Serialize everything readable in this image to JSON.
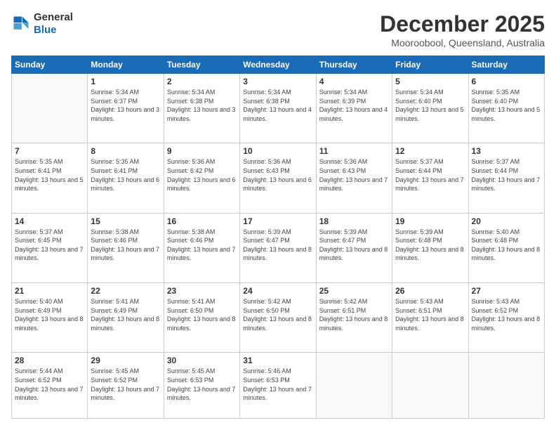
{
  "logo": {
    "line1": "General",
    "line2": "Blue"
  },
  "title": "December 2025",
  "subtitle": "Mooroobool, Queensland, Australia",
  "days_of_week": [
    "Sunday",
    "Monday",
    "Tuesday",
    "Wednesday",
    "Thursday",
    "Friday",
    "Saturday"
  ],
  "weeks": [
    [
      {
        "day": "",
        "sunrise": "",
        "sunset": "",
        "daylight": ""
      },
      {
        "day": "1",
        "sunrise": "Sunrise: 5:34 AM",
        "sunset": "Sunset: 6:37 PM",
        "daylight": "Daylight: 13 hours and 3 minutes."
      },
      {
        "day": "2",
        "sunrise": "Sunrise: 5:34 AM",
        "sunset": "Sunset: 6:38 PM",
        "daylight": "Daylight: 13 hours and 3 minutes."
      },
      {
        "day": "3",
        "sunrise": "Sunrise: 5:34 AM",
        "sunset": "Sunset: 6:38 PM",
        "daylight": "Daylight: 13 hours and 4 minutes."
      },
      {
        "day": "4",
        "sunrise": "Sunrise: 5:34 AM",
        "sunset": "Sunset: 6:39 PM",
        "daylight": "Daylight: 13 hours and 4 minutes."
      },
      {
        "day": "5",
        "sunrise": "Sunrise: 5:34 AM",
        "sunset": "Sunset: 6:40 PM",
        "daylight": "Daylight: 13 hours and 5 minutes."
      },
      {
        "day": "6",
        "sunrise": "Sunrise: 5:35 AM",
        "sunset": "Sunset: 6:40 PM",
        "daylight": "Daylight: 13 hours and 5 minutes."
      }
    ],
    [
      {
        "day": "7",
        "sunrise": "Sunrise: 5:35 AM",
        "sunset": "Sunset: 6:41 PM",
        "daylight": "Daylight: 13 hours and 5 minutes."
      },
      {
        "day": "8",
        "sunrise": "Sunrise: 5:35 AM",
        "sunset": "Sunset: 6:41 PM",
        "daylight": "Daylight: 13 hours and 6 minutes."
      },
      {
        "day": "9",
        "sunrise": "Sunrise: 5:36 AM",
        "sunset": "Sunset: 6:42 PM",
        "daylight": "Daylight: 13 hours and 6 minutes."
      },
      {
        "day": "10",
        "sunrise": "Sunrise: 5:36 AM",
        "sunset": "Sunset: 6:43 PM",
        "daylight": "Daylight: 13 hours and 6 minutes."
      },
      {
        "day": "11",
        "sunrise": "Sunrise: 5:36 AM",
        "sunset": "Sunset: 6:43 PM",
        "daylight": "Daylight: 13 hours and 7 minutes."
      },
      {
        "day": "12",
        "sunrise": "Sunrise: 5:37 AM",
        "sunset": "Sunset: 6:44 PM",
        "daylight": "Daylight: 13 hours and 7 minutes."
      },
      {
        "day": "13",
        "sunrise": "Sunrise: 5:37 AM",
        "sunset": "Sunset: 6:44 PM",
        "daylight": "Daylight: 13 hours and 7 minutes."
      }
    ],
    [
      {
        "day": "14",
        "sunrise": "Sunrise: 5:37 AM",
        "sunset": "Sunset: 6:45 PM",
        "daylight": "Daylight: 13 hours and 7 minutes."
      },
      {
        "day": "15",
        "sunrise": "Sunrise: 5:38 AM",
        "sunset": "Sunset: 6:46 PM",
        "daylight": "Daylight: 13 hours and 7 minutes."
      },
      {
        "day": "16",
        "sunrise": "Sunrise: 5:38 AM",
        "sunset": "Sunset: 6:46 PM",
        "daylight": "Daylight: 13 hours and 7 minutes."
      },
      {
        "day": "17",
        "sunrise": "Sunrise: 5:39 AM",
        "sunset": "Sunset: 6:47 PM",
        "daylight": "Daylight: 13 hours and 8 minutes."
      },
      {
        "day": "18",
        "sunrise": "Sunrise: 5:39 AM",
        "sunset": "Sunset: 6:47 PM",
        "daylight": "Daylight: 13 hours and 8 minutes."
      },
      {
        "day": "19",
        "sunrise": "Sunrise: 5:39 AM",
        "sunset": "Sunset: 6:48 PM",
        "daylight": "Daylight: 13 hours and 8 minutes."
      },
      {
        "day": "20",
        "sunrise": "Sunrise: 5:40 AM",
        "sunset": "Sunset: 6:48 PM",
        "daylight": "Daylight: 13 hours and 8 minutes."
      }
    ],
    [
      {
        "day": "21",
        "sunrise": "Sunrise: 5:40 AM",
        "sunset": "Sunset: 6:49 PM",
        "daylight": "Daylight: 13 hours and 8 minutes."
      },
      {
        "day": "22",
        "sunrise": "Sunrise: 5:41 AM",
        "sunset": "Sunset: 6:49 PM",
        "daylight": "Daylight: 13 hours and 8 minutes."
      },
      {
        "day": "23",
        "sunrise": "Sunrise: 5:41 AM",
        "sunset": "Sunset: 6:50 PM",
        "daylight": "Daylight: 13 hours and 8 minutes."
      },
      {
        "day": "24",
        "sunrise": "Sunrise: 5:42 AM",
        "sunset": "Sunset: 6:50 PM",
        "daylight": "Daylight: 13 hours and 8 minutes."
      },
      {
        "day": "25",
        "sunrise": "Sunrise: 5:42 AM",
        "sunset": "Sunset: 6:51 PM",
        "daylight": "Daylight: 13 hours and 8 minutes."
      },
      {
        "day": "26",
        "sunrise": "Sunrise: 5:43 AM",
        "sunset": "Sunset: 6:51 PM",
        "daylight": "Daylight: 13 hours and 8 minutes."
      },
      {
        "day": "27",
        "sunrise": "Sunrise: 5:43 AM",
        "sunset": "Sunset: 6:52 PM",
        "daylight": "Daylight: 13 hours and 8 minutes."
      }
    ],
    [
      {
        "day": "28",
        "sunrise": "Sunrise: 5:44 AM",
        "sunset": "Sunset: 6:52 PM",
        "daylight": "Daylight: 13 hours and 7 minutes."
      },
      {
        "day": "29",
        "sunrise": "Sunrise: 5:45 AM",
        "sunset": "Sunset: 6:52 PM",
        "daylight": "Daylight: 13 hours and 7 minutes."
      },
      {
        "day": "30",
        "sunrise": "Sunrise: 5:45 AM",
        "sunset": "Sunset: 6:53 PM",
        "daylight": "Daylight: 13 hours and 7 minutes."
      },
      {
        "day": "31",
        "sunrise": "Sunrise: 5:46 AM",
        "sunset": "Sunset: 6:53 PM",
        "daylight": "Daylight: 13 hours and 7 minutes."
      },
      {
        "day": "",
        "sunrise": "",
        "sunset": "",
        "daylight": ""
      },
      {
        "day": "",
        "sunrise": "",
        "sunset": "",
        "daylight": ""
      },
      {
        "day": "",
        "sunrise": "",
        "sunset": "",
        "daylight": ""
      }
    ]
  ]
}
